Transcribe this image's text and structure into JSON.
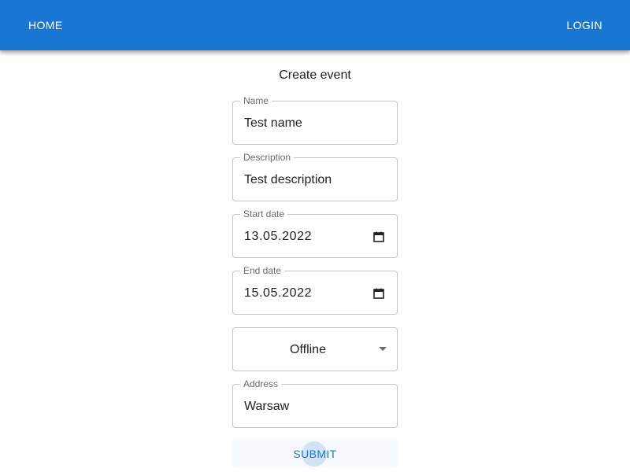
{
  "nav": {
    "home_label": "HOME",
    "login_label": "LOGIN"
  },
  "form": {
    "title": "Create event",
    "fields": {
      "name": {
        "label": "Name",
        "value": "Test name"
      },
      "description": {
        "label": "Description",
        "value": "Test description"
      },
      "start_date": {
        "label": "Start date",
        "value": "13.05.2022",
        "icon": "calendar-icon"
      },
      "end_date": {
        "label": "End date",
        "value": "15.05.2022",
        "icon": "calendar-icon"
      },
      "type": {
        "value": "Offline",
        "icon": "dropdown-arrow-icon"
      },
      "address": {
        "label": "Address",
        "value": "Warsaw"
      }
    },
    "submit_label": "SUBMIT"
  },
  "colors": {
    "app_bar": "#1976d2",
    "primary_text_button": "#1976d2",
    "field_border": "#c4c4c4"
  }
}
